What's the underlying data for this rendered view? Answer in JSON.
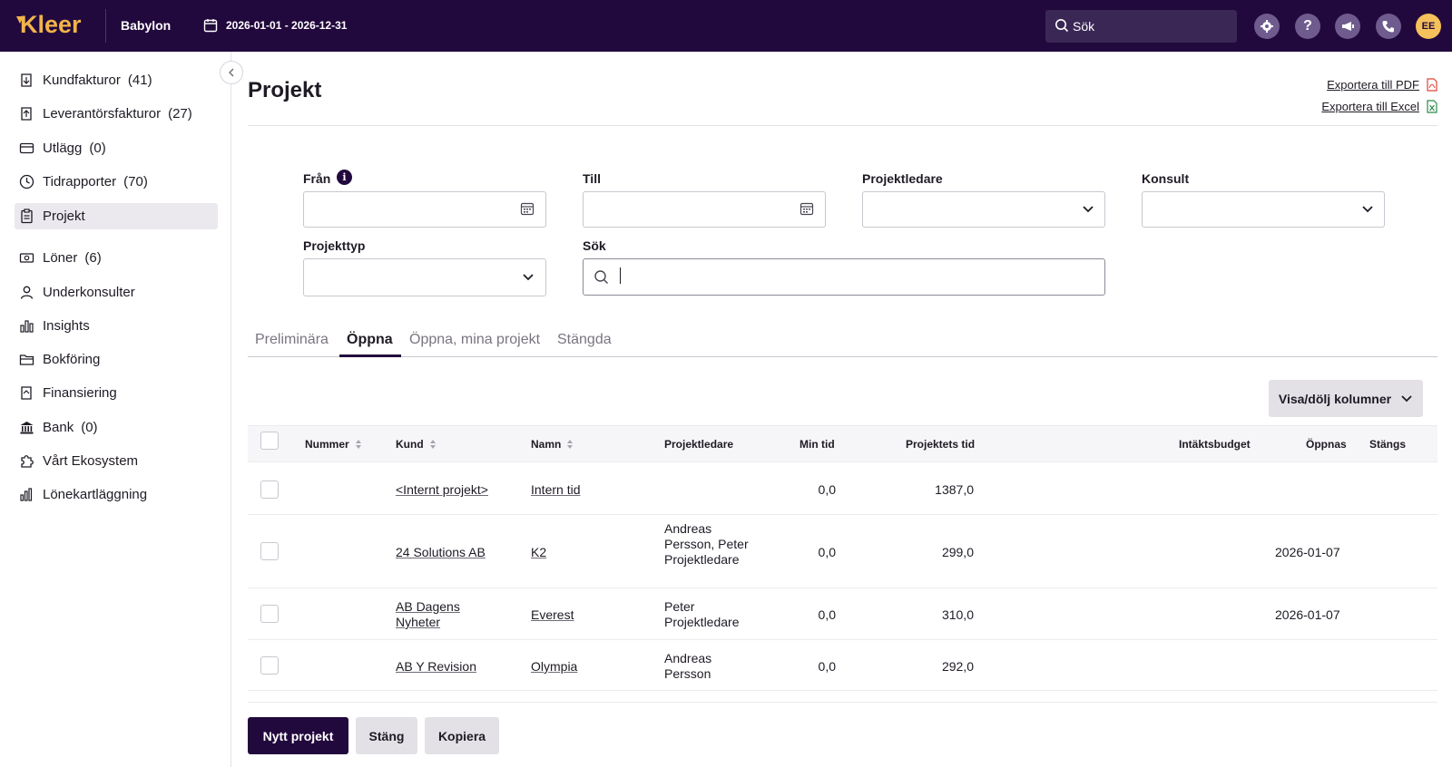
{
  "topbar": {
    "logo": "Kleer",
    "company": "Babylon",
    "period": "2026-01-01 - 2026-12-31",
    "search_placeholder": "Sök",
    "avatar_initials": "EE"
  },
  "sidebar": {
    "items": [
      {
        "label": "Kundfakturor",
        "count": "(41)",
        "icon": "invoice-icon"
      },
      {
        "label": "Leverantörsfakturor",
        "count": "(27)",
        "icon": "supplier-invoice-icon"
      },
      {
        "label": "Utlägg",
        "count": "(0)",
        "icon": "card-icon"
      },
      {
        "label": "Tidrapporter",
        "count": "(70)",
        "icon": "clock-icon"
      },
      {
        "label": "Projekt",
        "count": "",
        "icon": "clipboard-icon",
        "active": true
      },
      {
        "label": "Löner",
        "count": "(6)",
        "icon": "money-icon"
      },
      {
        "label": "Underkonsulter",
        "count": "",
        "icon": "person-icon"
      },
      {
        "label": "Insights",
        "count": "",
        "icon": "bar-chart-icon"
      },
      {
        "label": "Bokföring",
        "count": "",
        "icon": "folder-icon"
      },
      {
        "label": "Finansiering",
        "count": "",
        "icon": "finance-icon"
      },
      {
        "label": "Bank",
        "count": "(0)",
        "icon": "bank-icon"
      },
      {
        "label": "Vårt Ekosystem",
        "count": "",
        "icon": "puzzle-icon"
      },
      {
        "label": "Lönekartläggning",
        "count": "",
        "icon": "salary-chart-icon"
      }
    ]
  },
  "page": {
    "title": "Projekt",
    "export_pdf": "Exportera till PDF",
    "export_excel": "Exportera till Excel"
  },
  "filters": {
    "from_label": "Från",
    "to_label": "Till",
    "manager_label": "Projektledare",
    "consultant_label": "Konsult",
    "type_label": "Projekttyp",
    "search_label": "Sök",
    "from_value": "",
    "to_value": "",
    "search_value": ""
  },
  "tabs": [
    {
      "label": "Preliminära",
      "active": false
    },
    {
      "label": "Öppna",
      "active": true
    },
    {
      "label": "Öppna, mina projekt",
      "active": false
    },
    {
      "label": "Stängda",
      "active": false
    }
  ],
  "columns_button": "Visa/dölj kolumner",
  "table": {
    "headers": {
      "number": "Nummer",
      "customer": "Kund",
      "name": "Namn",
      "manager": "Projektledare",
      "my_time": "Min tid",
      "project_time": "Projektets tid",
      "revenue_budget": "Intäktsbudget",
      "opens": "Öppnas",
      "closes": "Stängs"
    },
    "rows": [
      {
        "number": "",
        "customer": "<Internt projekt>",
        "name": "Intern tid",
        "manager": "",
        "my_time": "0,0",
        "project_time": "1387,0",
        "opens": "",
        "closes": ""
      },
      {
        "number": "",
        "customer": "24 Solutions AB",
        "name": "K2",
        "manager": "Andreas Persson, Peter Projektledare",
        "my_time": "0,0",
        "project_time": "299,0",
        "opens": "2026-01-07",
        "closes": ""
      },
      {
        "number": "",
        "customer": "AB Dagens Nyheter",
        "name": "Everest",
        "manager": "Peter Projektledare",
        "my_time": "0,0",
        "project_time": "310,0",
        "opens": "2026-01-07",
        "closes": ""
      },
      {
        "number": "",
        "customer": "AB Y Revision",
        "name": "Olympia",
        "manager": "Andreas Persson",
        "my_time": "0,0",
        "project_time": "292,0",
        "opens": "",
        "closes": ""
      }
    ]
  },
  "actions": {
    "new_project": "Nytt projekt",
    "close": "Stäng",
    "copy": "Kopiera"
  },
  "colors": {
    "brand_dark": "#22093d",
    "brand_accent": "#f1b44a"
  }
}
